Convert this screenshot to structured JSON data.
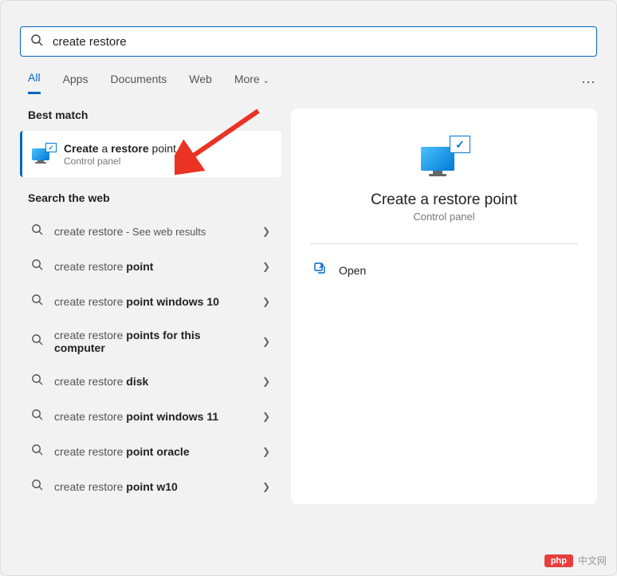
{
  "search": {
    "value": "create restore "
  },
  "tabs": [
    "All",
    "Apps",
    "Documents",
    "Web",
    "More"
  ],
  "activeTab": 0,
  "sections": {
    "best": "Best match",
    "web": "Search the web"
  },
  "bestMatch": {
    "title_pre": "Create",
    "title_light": " a ",
    "title_bold": "restore",
    "title_post": " point",
    "sub": "Control panel"
  },
  "webResults": [
    {
      "plain": "create restore",
      "bold": "",
      "suffix": " - See web results"
    },
    {
      "plain": "create restore ",
      "bold": "point",
      "suffix": ""
    },
    {
      "plain": "create restore ",
      "bold": "point windows 10",
      "suffix": ""
    },
    {
      "plain": "create restore ",
      "bold": "points for this computer",
      "suffix": ""
    },
    {
      "plain": "create restore ",
      "bold": "disk",
      "suffix": ""
    },
    {
      "plain": "create restore ",
      "bold": "point windows 11",
      "suffix": ""
    },
    {
      "plain": "create restore ",
      "bold": "point oracle",
      "suffix": ""
    },
    {
      "plain": "create restore ",
      "bold": "point w10",
      "suffix": ""
    }
  ],
  "preview": {
    "title": "Create a restore point",
    "sub": "Control panel"
  },
  "actions": {
    "open": "Open"
  },
  "colors": {
    "accent": "#0067c0",
    "arrow": "#ea3323"
  },
  "watermark": {
    "badge": "php",
    "text": "中文网"
  }
}
